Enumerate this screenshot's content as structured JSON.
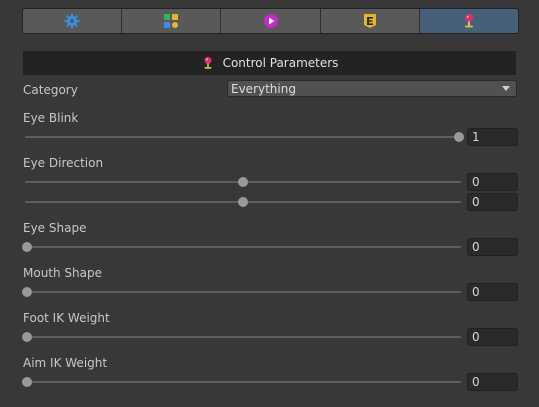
{
  "toolbar": {
    "tabs": [
      {
        "icon": "gear-icon",
        "active": false
      },
      {
        "icon": "blocks-icon",
        "active": false
      },
      {
        "icon": "play-icon",
        "active": false
      },
      {
        "icon": "e-badge-icon",
        "active": false
      },
      {
        "icon": "joystick-icon",
        "active": true
      }
    ]
  },
  "header": {
    "title": "Control Parameters",
    "icon": "joystick-icon"
  },
  "category": {
    "label": "Category",
    "value": "Everything"
  },
  "params": [
    {
      "label": "Eye Blink",
      "sliders": [
        {
          "value": 1,
          "fraction": 1.0
        }
      ]
    },
    {
      "label": "Eye Direction",
      "sliders": [
        {
          "value": 0,
          "fraction": 0.5
        },
        {
          "value": 0,
          "fraction": 0.5
        }
      ]
    },
    {
      "label": "Eye Shape",
      "sliders": [
        {
          "value": 0,
          "fraction": 0.0
        }
      ]
    },
    {
      "label": "Mouth Shape",
      "sliders": [
        {
          "value": 0,
          "fraction": 0.0
        }
      ]
    },
    {
      "label": "Foot IK Weight",
      "sliders": [
        {
          "value": 0,
          "fraction": 0.0
        }
      ]
    },
    {
      "label": "Aim IK Weight",
      "sliders": [
        {
          "value": 0,
          "fraction": 0.0
        }
      ]
    }
  ],
  "colors": {
    "active_tab": "#46607c",
    "panel": "#383838",
    "header_bg": "#232323"
  }
}
